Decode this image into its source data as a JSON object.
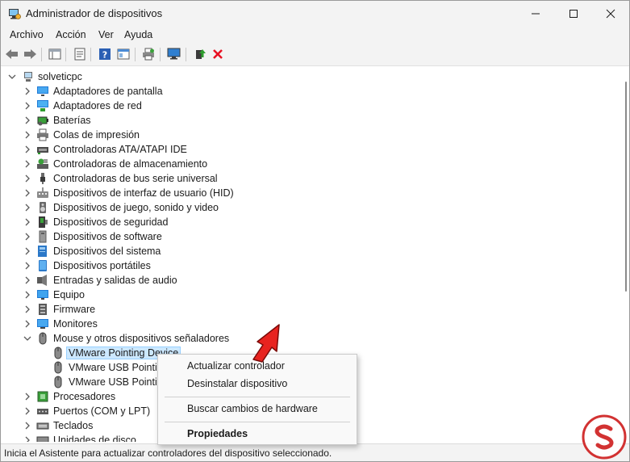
{
  "window": {
    "title": "Administrador de dispositivos"
  },
  "menubar": [
    "Archivo",
    "Acción",
    "Ver",
    "Ayuda"
  ],
  "tree": {
    "root": "solveticpc",
    "categories": [
      "Adaptadores de pantalla",
      "Adaptadores de red",
      "Baterías",
      "Colas de impresión",
      "Controladoras ATA/ATAPI IDE",
      "Controladoras de almacenamiento",
      "Controladoras de bus serie universal",
      "Dispositivos de interfaz de usuario (HID)",
      "Dispositivos de juego, sonido y video",
      "Dispositivos de seguridad",
      "Dispositivos de software",
      "Dispositivos del sistema",
      "Dispositivos portátiles",
      "Entradas y salidas de audio",
      "Equipo",
      "Firmware",
      "Monitores",
      "Mouse y otros dispositivos señaladores"
    ],
    "mouse_children": [
      "VMware Pointing Device",
      "VMware USB Pointin",
      "VMware USB Pointin"
    ],
    "after": [
      "Procesadores",
      "Puertos (COM y LPT)",
      "Teclados",
      "Unidades de disco"
    ]
  },
  "context_menu": {
    "update_driver": "Actualizar controlador",
    "uninstall_device": "Desinstalar dispositivo",
    "scan_hardware": "Buscar cambios de hardware",
    "properties": "Propiedades"
  },
  "statusbar": {
    "text": "Inicia el Asistente para actualizar controladores del dispositivo seleccionado."
  },
  "colors": {
    "selection": "#cce8ff",
    "selection_border": "#99d1ff",
    "arrow": "#e8231f",
    "delete": "#e81123"
  }
}
